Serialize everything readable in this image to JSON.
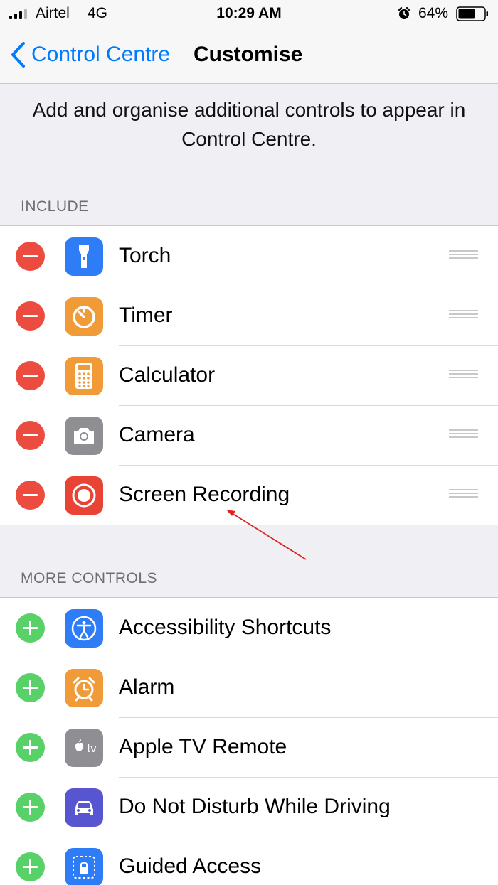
{
  "status_bar": {
    "carrier": "Airtel",
    "network": "4G",
    "time": "10:29 AM",
    "battery_percent": "64%",
    "signal_bars_filled": 3,
    "signal_bars_total": 4
  },
  "nav": {
    "back_label": "Control Centre",
    "title": "Customise"
  },
  "description": "Add and organise additional controls to appear in Control Centre.",
  "include": {
    "header": "INCLUDE",
    "items": [
      {
        "label": "Torch",
        "icon": "torch-icon",
        "color": "#2e7cf6"
      },
      {
        "label": "Timer",
        "icon": "timer-icon",
        "color": "#f19a38"
      },
      {
        "label": "Calculator",
        "icon": "calculator-icon",
        "color": "#f19a38"
      },
      {
        "label": "Camera",
        "icon": "camera-icon",
        "color": "#8e8e93"
      },
      {
        "label": "Screen Recording",
        "icon": "screen-recording-icon",
        "color": "#e84334"
      }
    ]
  },
  "more_controls": {
    "header": "MORE CONTROLS",
    "items": [
      {
        "label": "Accessibility Shortcuts",
        "icon": "accessibility-icon",
        "color": "#2e7cf6"
      },
      {
        "label": "Alarm",
        "icon": "alarm-icon",
        "color": "#f19a38"
      },
      {
        "label": "Apple TV Remote",
        "icon": "apple-tv-icon",
        "color": "#8e8e93",
        "icon_text": "tv"
      },
      {
        "label": "Do Not Disturb While Driving",
        "icon": "car-icon",
        "color": "#5755d0"
      },
      {
        "label": "Guided Access",
        "icon": "guided-access-icon",
        "color": "#2e7cf6"
      }
    ]
  },
  "colors": {
    "accent": "#007aff",
    "remove": "#ec4b3f",
    "add": "#57d168",
    "annotation_arrow": "#e0231d"
  }
}
